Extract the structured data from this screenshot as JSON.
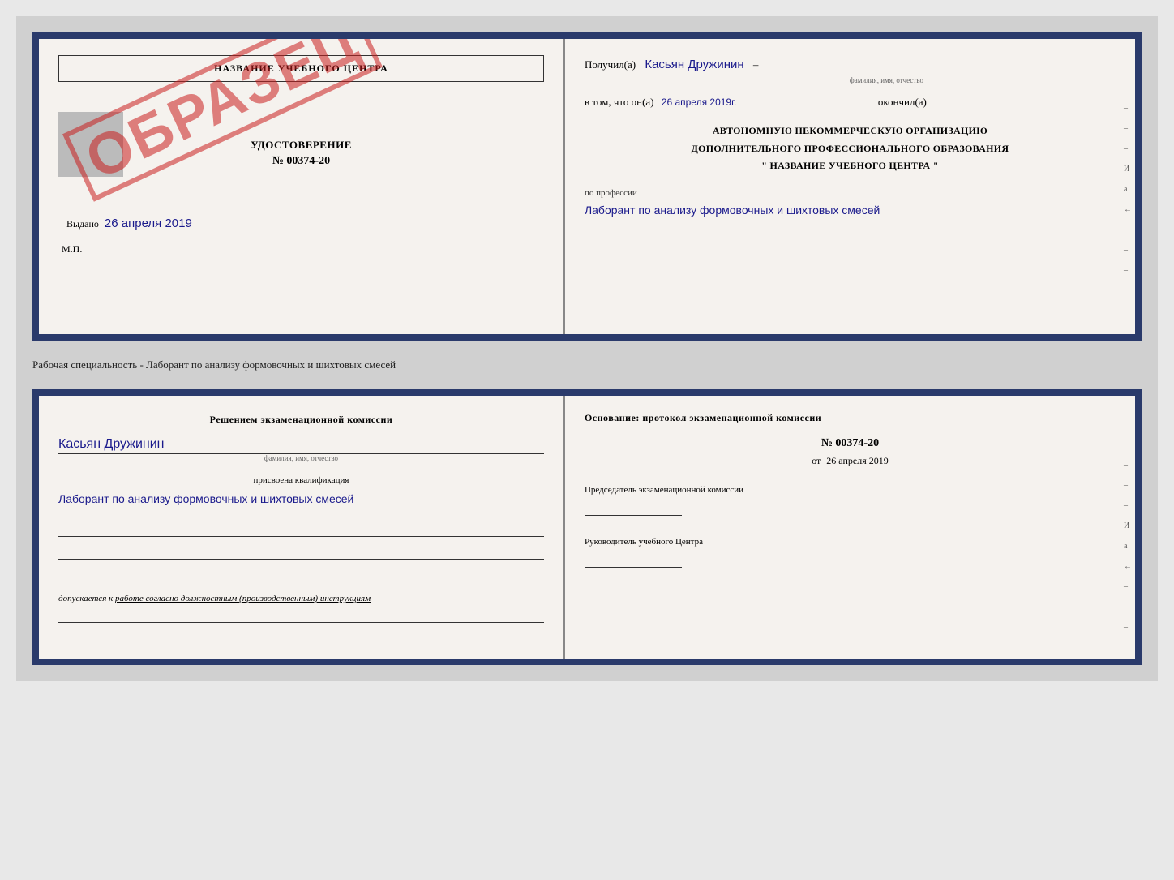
{
  "top_card": {
    "left": {
      "title": "НАЗВАНИЕ УЧЕБНОГО ЦЕНТРА",
      "cert_label": "УДОСТОВЕРЕНИЕ",
      "cert_number": "№ 00374-20",
      "vydano_label": "Выдано",
      "vydano_date": "26 апреля 2019",
      "mp_label": "М.П.",
      "stamp": "ОБРАЗЕЦ"
    },
    "right": {
      "poluchil_label": "Получил(a)",
      "poluchil_name": "Касьян Дружинин",
      "fio_small": "фамилия, имя, отчество",
      "vtom_label": "в том, что он(а)",
      "date_value": "26 апреля 2019г.",
      "okonchil_label": "окончил(а)",
      "anko_line1": "АВТОНОМНУЮ НЕКОММЕРЧЕСКУЮ ОРГАНИЗАЦИЮ",
      "anko_line2": "ДОПОЛНИТЕЛЬНОГО ПРОФЕССИОНАЛЬНОГО ОБРАЗОВАНИЯ",
      "anko_line3": "\" НАЗВАНИЕ УЧЕБНОГО ЦЕНТРА \"",
      "prof_label": "по профессии",
      "prof_value": "Лаборант по анализу формовочных и шихтовых смесей"
    }
  },
  "specialty_line": "Рабочая специальность - Лаборант по анализу формовочных и шихтовых смесей",
  "bottom_card": {
    "left": {
      "komissia_label": "Решением экзаменационной комиссии",
      "name_value": "Касьян Дружинин",
      "fio_small": "фамилия, имя, отчество",
      "prisvoena_label": "присвоена квалификация",
      "kvalif_value": "Лаборант по анализу формовочных и шихтовых смесей",
      "dopusk_label": "допускается к",
      "dopusk_value": "работе согласно должностным (производственным) инструкциям"
    },
    "right": {
      "osnov_label": "Основание: протокол экзаменационной комиссии",
      "protocol_num": "№ 00374-20",
      "ot_label": "от",
      "ot_date": "26 апреля 2019",
      "predsed_label": "Председатель экзаменационной комиссии",
      "rukv_label": "Руководитель учебного Центра"
    }
  },
  "side_marks": [
    "-",
    "-",
    "-",
    "И",
    "а",
    "←",
    "-",
    "-",
    "-"
  ]
}
